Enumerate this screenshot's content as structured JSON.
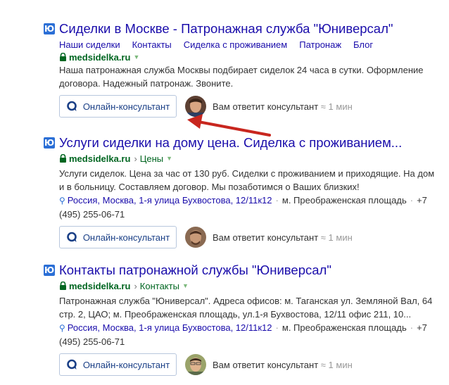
{
  "results": [
    {
      "favicon": "Ю",
      "title": "Сиделки в Москве - Патронажная служба \"Юниверсал\"",
      "sitelinks": [
        "Наши сиделки",
        "Контакты",
        "Сиделка с проживанием",
        "Патронаж",
        "Блог"
      ],
      "domain": "medsidelka.ru",
      "snippet": "Наша патронажная служба Москвы подбирает сиделок 24 часа в сутки. Оформление договора. Надежный патронаж. Звоните.",
      "consult_label": "Онлайн-консультант",
      "answer_text": "Вам ответит консультант",
      "answer_time": "≈ 1 мин"
    },
    {
      "favicon": "Ю",
      "title": "Услуги сиделки на дому цена. Сиделка с проживанием...",
      "domain": "medsidelka.ru",
      "crumb": "Цены",
      "snippet": "Услуги сиделок. Цена за час от 130 руб. Сиделки с проживанием и приходящие. На дом и в больницу. Составляем договор. Мы позаботимся о Ваших близких!",
      "address": "Россия, Москва, 1-я улица Бухвостова, 12/11к12",
      "metro": "м. Преображенская площадь",
      "phone": "+7 (495) 255-06-71",
      "consult_label": "Онлайн-консультант",
      "answer_text": "Вам ответит консультант",
      "answer_time": "≈ 1 мин"
    },
    {
      "favicon": "Ю",
      "title": "Контакты патронажной службы \"Юниверсал\"",
      "domain": "medsidelka.ru",
      "crumb": "Контакты",
      "snippet": "Патронажная служба \"Юниверсал\". Адреса офисов: м. Таганская ул. Земляной Вал, 64 стр. 2, ЦАО; м. Преображенская площадь, ул.1-я Бухвостова, 12/11 офис 211, 10...",
      "address": "Россия, Москва, 1-я улица Бухвостова, 12/11к12",
      "metro": "м. Преображенская площадь",
      "phone": "+7 (495) 255-06-71",
      "consult_label": "Онлайн-консультант",
      "answer_text": "Вам ответит консультант",
      "answer_time": "≈ 1 мин"
    }
  ],
  "icons": {
    "favicon": "yu-favicon-icon",
    "lock": "lock-icon",
    "chevron": "chevron-down-icon",
    "pin": "location-pin-icon",
    "chat": "chat-bubble-icon",
    "arrow": "red-arrow-annotation"
  },
  "colors": {
    "title": "#1a0dab",
    "url": "#006621",
    "favicon_bg": "#2b6fd6",
    "arrow": "#c8261e",
    "button_border": "#b8c7dd"
  }
}
